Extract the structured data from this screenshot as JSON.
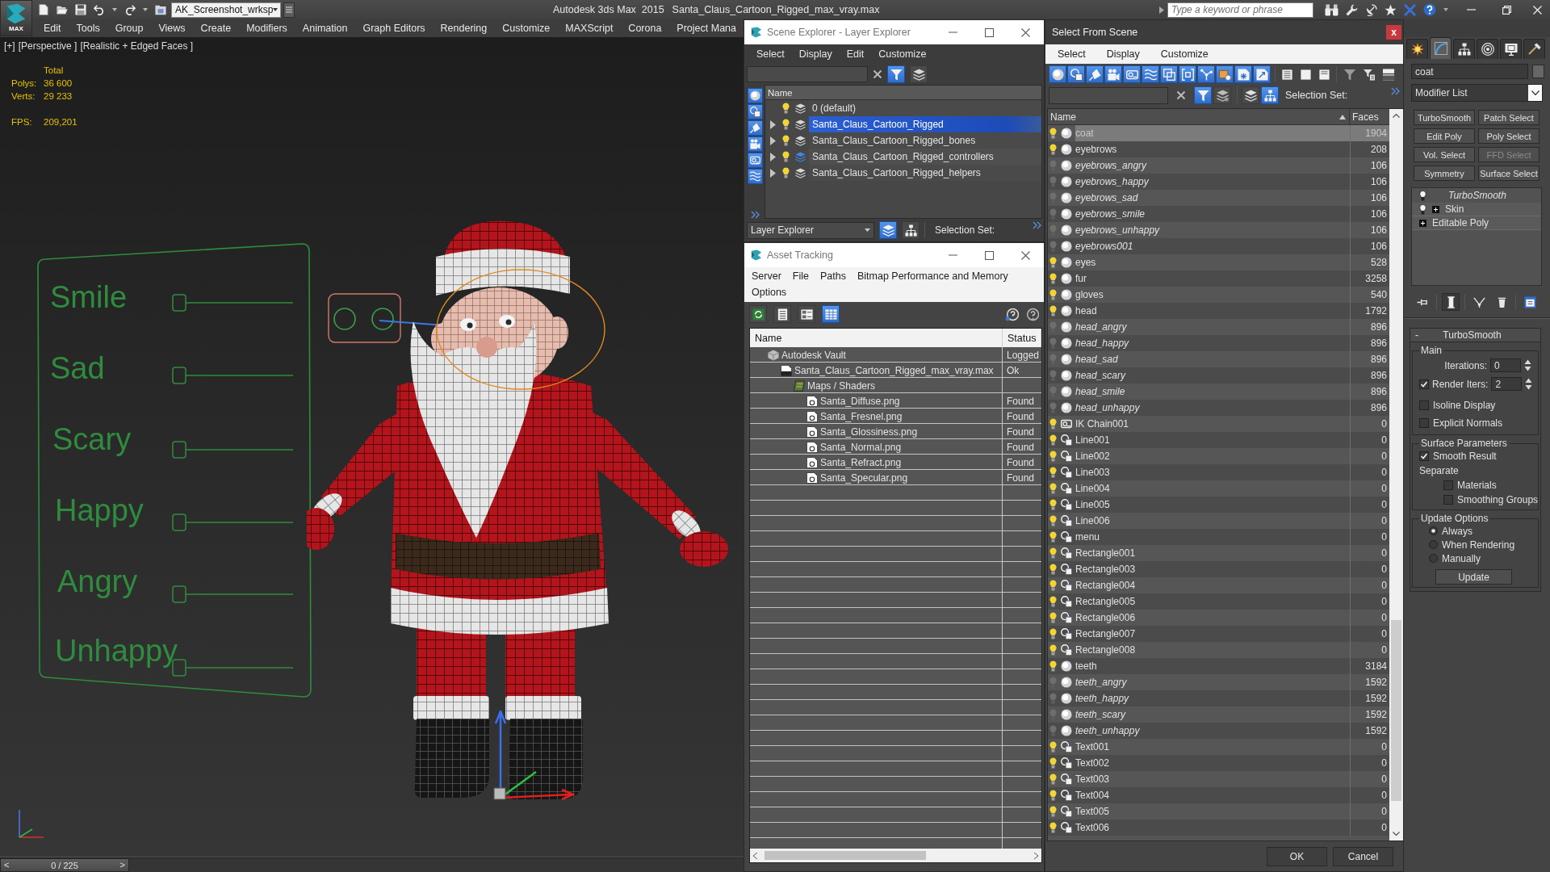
{
  "app": {
    "logo": "MAX",
    "workspace": "AK_Screenshot_wrksp",
    "title": "Autodesk 3ds Max  2015",
    "file": "Santa_Claus_Cartoon_Rigged_max_vray.max",
    "search": {
      "placeholder": "Type a keyword or phrase"
    }
  },
  "menu_bar": [
    "Edit",
    "Tools",
    "Group",
    "Views",
    "Create",
    "Modifiers",
    "Animation",
    "Graph Editors",
    "Rendering",
    "Customize",
    "MAXScript",
    "Corona",
    "Project Mana"
  ],
  "viewport": {
    "labels": [
      "[+]",
      "[Perspective ]",
      "[Realistic + Edged Faces ]"
    ],
    "stats": {
      "heading": "Total",
      "rows": [
        {
          "label": "Polys:",
          "value": "36 600"
        },
        {
          "label": "Verts:",
          "value": "29 233"
        }
      ],
      "fps": {
        "label": "FPS:",
        "value": "209,201"
      }
    },
    "rig_controls": [
      "Smile",
      "Sad",
      "Scary",
      "Happy",
      "Angry",
      "Unhappy"
    ]
  },
  "timeline": {
    "prev": "<",
    "reading": "0 / 225",
    "next": ">",
    "level": 0
  },
  "scene_explorer": {
    "title": "Scene Explorer - Layer Explorer",
    "menu": [
      "Select",
      "Display",
      "Edit",
      "Customize"
    ],
    "tool_toggles": [
      {
        "selected": true
      },
      {
        "selected": false
      }
    ],
    "type_filters": [
      {
        "on": true
      },
      {
        "on": true
      },
      {
        "on": true
      },
      {
        "on": true
      },
      {
        "on": true
      },
      {
        "on": true
      }
    ],
    "column": "Name",
    "layers": [
      {
        "name": "0 (default)",
        "has_children": false,
        "hidden": false,
        "current": false,
        "selected": false
      },
      {
        "name": "Santa_Claus_Cartoon_Rigged",
        "has_children": true,
        "expanded": false,
        "hidden": false,
        "current": false,
        "selected": true
      },
      {
        "name": "Santa_Claus_Cartoon_Rigged_bones",
        "has_children": true,
        "expanded": false,
        "hidden": false,
        "current": false,
        "selected": false
      },
      {
        "name": "Santa_Claus_Cartoon_Rigged_controllers",
        "has_children": true,
        "expanded": false,
        "hidden": false,
        "current": true,
        "selected": false
      },
      {
        "name": "Santa_Claus_Cartoon_Rigged_helpers",
        "has_children": true,
        "expanded": false,
        "hidden": false,
        "current": false,
        "selected": false
      }
    ],
    "footer": {
      "mode": "Layer Explorer",
      "views": [
        {
          "selected": true
        },
        {
          "selected": false
        }
      ],
      "selection_set": "Selection Set:"
    }
  },
  "asset_tracking": {
    "title": "Asset Tracking",
    "menu": [
      "Server",
      "File",
      "Paths",
      "Bitmap Performance and Memory",
      "Options"
    ],
    "views": [
      {
        "selected": false
      },
      {
        "selected": false
      },
      {
        "selected": false
      },
      {
        "selected": true
      }
    ],
    "columns": [
      "Name",
      "Status"
    ],
    "tree": [
      {
        "name": "Autodesk Vault",
        "status": "Logged",
        "kind": "vault",
        "children": [
          {
            "name": "Santa_Claus_Cartoon_Rigged_max_vray.max",
            "status": "Ok",
            "kind": "max_file",
            "children": [
              {
                "name": "Maps / Shaders",
                "kind": "folder",
                "children": [
                  {
                    "name": "Santa_Diffuse.png",
                    "status": "Found",
                    "kind": "bitmap"
                  },
                  {
                    "name": "Santa_Fresnel.png",
                    "status": "Found",
                    "kind": "bitmap"
                  },
                  {
                    "name": "Santa_Glossiness.png",
                    "status": "Found",
                    "kind": "bitmap"
                  },
                  {
                    "name": "Santa_Normal.png",
                    "status": "Found",
                    "kind": "bitmap"
                  },
                  {
                    "name": "Santa_Refract.png",
                    "status": "Found",
                    "kind": "bitmap"
                  },
                  {
                    "name": "Santa_Specular.png",
                    "status": "Found",
                    "kind": "bitmap"
                  }
                ]
              }
            ]
          }
        ]
      }
    ]
  },
  "select_from_scene": {
    "title": "Select From Scene",
    "close": "x",
    "menu": [
      "Select",
      "Display",
      "Customize"
    ],
    "type_filters": [
      {
        "on": true
      },
      {
        "on": true
      },
      {
        "on": true
      },
      {
        "on": true
      },
      {
        "on": true
      },
      {
        "on": true
      },
      {
        "on": true
      },
      {
        "on": true
      },
      {
        "on": true
      },
      {
        "on": true
      },
      {
        "on": true
      },
      {
        "on": true
      }
    ],
    "display_toggles": [
      {
        "selected": true
      },
      {
        "selected": false
      },
      {
        "selected": false
      },
      {
        "selected": true
      }
    ],
    "selection_set": "Selection Set:",
    "columns": [
      "Name",
      "Faces"
    ],
    "rows": [
      {
        "name": "coat",
        "faces": "1904",
        "kind": "geometry",
        "hidden": false,
        "selected": true
      },
      {
        "name": "eyebrows",
        "faces": "208",
        "kind": "geometry",
        "hidden": false,
        "selected": false
      },
      {
        "name": "eyebrows_angry",
        "faces": "106",
        "kind": "geometry",
        "hidden": true,
        "selected": false
      },
      {
        "name": "eyebrows_happy",
        "faces": "106",
        "kind": "geometry",
        "hidden": true,
        "selected": false
      },
      {
        "name": "eyebrows_sad",
        "faces": "106",
        "kind": "geometry",
        "hidden": true,
        "selected": false
      },
      {
        "name": "eyebrows_smile",
        "faces": "106",
        "kind": "geometry",
        "hidden": true,
        "selected": false
      },
      {
        "name": "eyebrows_unhappy",
        "faces": "106",
        "kind": "geometry",
        "hidden": true,
        "selected": false
      },
      {
        "name": "eyebrows001",
        "faces": "106",
        "kind": "geometry",
        "hidden": true,
        "selected": false
      },
      {
        "name": "eyes",
        "faces": "528",
        "kind": "geometry",
        "hidden": false,
        "selected": false
      },
      {
        "name": "fur",
        "faces": "3258",
        "kind": "geometry",
        "hidden": false,
        "selected": false
      },
      {
        "name": "gloves",
        "faces": "540",
        "kind": "geometry",
        "hidden": false,
        "selected": false
      },
      {
        "name": "head",
        "faces": "1792",
        "kind": "geometry",
        "hidden": false,
        "selected": false
      },
      {
        "name": "head_angry",
        "faces": "896",
        "kind": "geometry",
        "hidden": true,
        "selected": false
      },
      {
        "name": "head_happy",
        "faces": "896",
        "kind": "geometry",
        "hidden": true,
        "selected": false
      },
      {
        "name": "head_sad",
        "faces": "896",
        "kind": "geometry",
        "hidden": true,
        "selected": false
      },
      {
        "name": "head_scary",
        "faces": "896",
        "kind": "geometry",
        "hidden": true,
        "selected": false
      },
      {
        "name": "head_smile",
        "faces": "896",
        "kind": "geometry",
        "hidden": true,
        "selected": false
      },
      {
        "name": "head_unhappy",
        "faces": "896",
        "kind": "geometry",
        "hidden": true,
        "selected": false
      },
      {
        "name": "IK Chain001",
        "faces": "0",
        "kind": "helper",
        "hidden": false,
        "selected": false
      },
      {
        "name": "Line001",
        "faces": "0",
        "kind": "shape",
        "hidden": false,
        "selected": false
      },
      {
        "name": "Line002",
        "faces": "0",
        "kind": "shape",
        "hidden": false,
        "selected": false
      },
      {
        "name": "Line003",
        "faces": "0",
        "kind": "shape",
        "hidden": false,
        "selected": false
      },
      {
        "name": "Line004",
        "faces": "0",
        "kind": "shape",
        "hidden": false,
        "selected": false
      },
      {
        "name": "Line005",
        "faces": "0",
        "kind": "shape",
        "hidden": false,
        "selected": false
      },
      {
        "name": "Line006",
        "faces": "0",
        "kind": "shape",
        "hidden": false,
        "selected": false
      },
      {
        "name": "menu",
        "faces": "0",
        "kind": "shape",
        "hidden": false,
        "selected": false
      },
      {
        "name": "Rectangle001",
        "faces": "0",
        "kind": "shape",
        "hidden": false,
        "selected": false
      },
      {
        "name": "Rectangle003",
        "faces": "0",
        "kind": "shape",
        "hidden": false,
        "selected": false
      },
      {
        "name": "Rectangle004",
        "faces": "0",
        "kind": "shape",
        "hidden": false,
        "selected": false
      },
      {
        "name": "Rectangle005",
        "faces": "0",
        "kind": "shape",
        "hidden": false,
        "selected": false
      },
      {
        "name": "Rectangle006",
        "faces": "0",
        "kind": "shape",
        "hidden": false,
        "selected": false
      },
      {
        "name": "Rectangle007",
        "faces": "0",
        "kind": "shape",
        "hidden": false,
        "selected": false
      },
      {
        "name": "Rectangle008",
        "faces": "0",
        "kind": "shape",
        "hidden": false,
        "selected": false
      },
      {
        "name": "teeth",
        "faces": "3184",
        "kind": "geometry",
        "hidden": false,
        "selected": false
      },
      {
        "name": "teeth_angry",
        "faces": "1592",
        "kind": "geometry",
        "hidden": true,
        "selected": false
      },
      {
        "name": "teeth_happy",
        "faces": "1592",
        "kind": "geometry",
        "hidden": true,
        "selected": false
      },
      {
        "name": "teeth_scary",
        "faces": "1592",
        "kind": "geometry",
        "hidden": true,
        "selected": false
      },
      {
        "name": "teeth_unhappy",
        "faces": "1592",
        "kind": "geometry",
        "hidden": true,
        "selected": false
      },
      {
        "name": "Text001",
        "faces": "0",
        "kind": "shape",
        "hidden": false,
        "selected": false
      },
      {
        "name": "Text002",
        "faces": "0",
        "kind": "shape",
        "hidden": false,
        "selected": false
      },
      {
        "name": "Text003",
        "faces": "0",
        "kind": "shape",
        "hidden": false,
        "selected": false
      },
      {
        "name": "Text004",
        "faces": "0",
        "kind": "shape",
        "hidden": false,
        "selected": false
      },
      {
        "name": "Text005",
        "faces": "0",
        "kind": "shape",
        "hidden": false,
        "selected": false
      },
      {
        "name": "Text006",
        "faces": "0",
        "kind": "shape",
        "hidden": false,
        "selected": false
      }
    ],
    "buttons": [
      "OK",
      "Cancel"
    ]
  },
  "command_panel": {
    "tabs": [
      {
        "selected": false
      },
      {
        "selected": true
      },
      {
        "selected": false
      },
      {
        "selected": false
      },
      {
        "selected": false
      },
      {
        "selected": false
      }
    ],
    "object_name": "coat",
    "modifier_list": "Modifier List",
    "modifier_buttons": [
      {
        "label": "TurboSmooth",
        "disabled": false
      },
      {
        "label": "Patch Select",
        "disabled": false
      },
      {
        "label": "Edit Poly",
        "disabled": false
      },
      {
        "label": "Poly Select",
        "disabled": false
      },
      {
        "label": "Vol. Select",
        "disabled": false
      },
      {
        "label": "FFD Select",
        "disabled": true
      },
      {
        "label": "Symmetry",
        "disabled": false
      },
      {
        "label": "Surface Select",
        "disabled": false
      }
    ],
    "stack": [
      {
        "name": "TurboSmooth",
        "kind": "modifier",
        "expandable": false,
        "viewport_off": true
      },
      {
        "name": "Skin",
        "kind": "modifier",
        "expandable": true,
        "viewport_off": false
      },
      {
        "name": "Editable Poly",
        "kind": "base",
        "expandable": true,
        "viewport_off": false
      }
    ],
    "stack_tools": [
      {
        "selected": false
      },
      {
        "selected": true
      },
      {
        "selected": false
      },
      {
        "selected": false
      },
      {
        "selected": false
      }
    ],
    "rollout": {
      "collapse": "-",
      "title": "TurboSmooth",
      "main": {
        "title": "Main",
        "iterations": {
          "label": "Iterations:",
          "value": "0"
        },
        "render_iters": {
          "label": "Render Iters:",
          "value": "2",
          "checked": true
        },
        "options": [
          {
            "label": "Isoline Display",
            "checked": false
          },
          {
            "label": "Explicit Normals",
            "checked": false
          }
        ]
      },
      "surface": {
        "title": "Surface Parameters",
        "smooth_result": {
          "label": "Smooth Result",
          "checked": true
        },
        "separate": "Separate",
        "options": [
          {
            "label": "Materials",
            "checked": false
          },
          {
            "label": "Smoothing Groups",
            "checked": false
          }
        ]
      },
      "update": {
        "title": "Update Options",
        "choices": [
          {
            "label": "Always",
            "selected": true
          },
          {
            "label": "When Rendering",
            "selected": false
          },
          {
            "label": "Manually",
            "selected": false
          }
        ],
        "button": "Update"
      }
    }
  }
}
